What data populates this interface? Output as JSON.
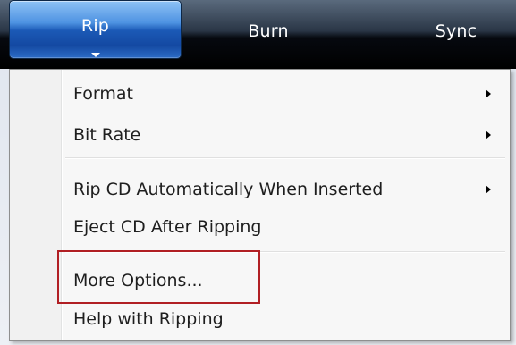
{
  "tabs": [
    {
      "id": "rip",
      "label": "Rip",
      "active": true
    },
    {
      "id": "burn",
      "label": "Burn",
      "active": false
    },
    {
      "id": "sync",
      "label": "Sync",
      "active": false
    }
  ],
  "menu": {
    "items": [
      {
        "label": "Format",
        "has_submenu": true
      },
      {
        "label": "Bit Rate",
        "has_submenu": true
      },
      {
        "label": "Rip CD Automatically When Inserted",
        "has_submenu": true
      },
      {
        "label": "Eject CD After Ripping",
        "has_submenu": false
      },
      {
        "label": "More Options...",
        "has_submenu": false,
        "highlighted": true
      },
      {
        "label": "Help with Ripping",
        "has_submenu": false
      }
    ]
  },
  "colors": {
    "active_tab": "#1b59b6",
    "highlight_border": "#b11f24",
    "menu_background": "#f7f7f7"
  },
  "icons": {
    "tab_dropdown": "chevron-down-icon",
    "submenu": "chevron-right-icon"
  }
}
